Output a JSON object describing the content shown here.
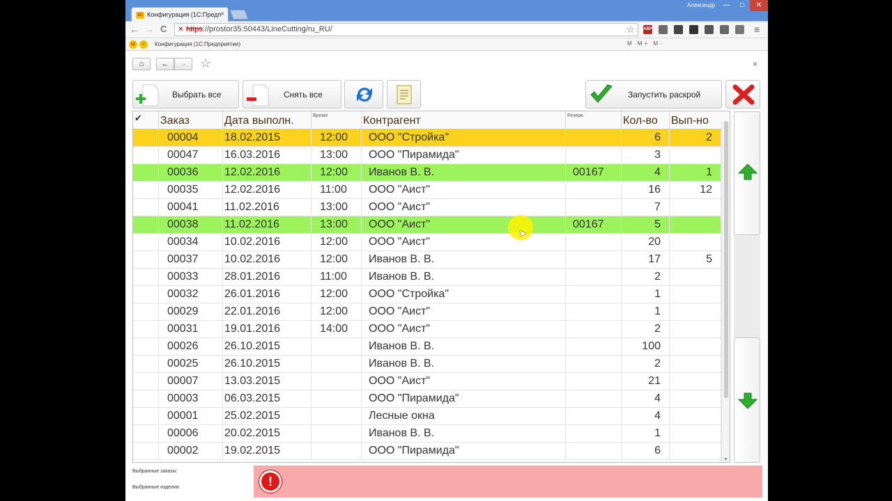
{
  "browser": {
    "tab_title": "Конфигурация (1С:Предп",
    "tab_favicon": "1С",
    "user": "Александр",
    "url_scheme": "https",
    "url_rest": "://prostor35:50443/LineCutting/ru_RU/",
    "bookmark_title": "Конфигурация  (1С:Предприятие)",
    "bookmark_logo": "1С",
    "toolbar_tools": "M M+ M-",
    "window_buttons": {
      "minimize": "—",
      "maximize": "□",
      "close": "✕"
    },
    "nav_icons": {
      "back": "←",
      "forward": "→",
      "reload": "C",
      "menu": "≡"
    },
    "extensions": [
      {
        "name": "adblock-icon",
        "label": "ABP",
        "color": "#c8201a"
      },
      {
        "name": "extension-icon-2",
        "label": "",
        "color": "#6a6a6a"
      },
      {
        "name": "extension-icon-3",
        "label": "",
        "color": "#444444"
      },
      {
        "name": "pocket-icon",
        "label": "",
        "color": "#333333"
      },
      {
        "name": "extension-icon-5",
        "label": "",
        "color": "#555555"
      },
      {
        "name": "extension-icon-6",
        "label": "",
        "color": "#666666"
      },
      {
        "name": "extension-icon-7",
        "label": "",
        "color": "#777777"
      }
    ]
  },
  "app": {
    "nav": {
      "home": "⌂",
      "back": "←",
      "forward": "→",
      "favorite": "☆"
    },
    "close": "×",
    "toolbar": {
      "select_all": "Выбрать все",
      "deselect_all": "Снять все",
      "start_cutting": "Запустить раскрой"
    },
    "table": {
      "headers": {
        "check": "✔",
        "order": "Заказ",
        "date": "Дата выполн.",
        "time": "Время",
        "counterparty": "Контрагент",
        "reserve": "Резерв",
        "qty": "Кол-во",
        "done": "Вып-но"
      },
      "rows": [
        {
          "order": "00004",
          "date": "18.02.2015",
          "time": "12:00",
          "counterparty": "ООО \"Стройка\"",
          "reserve": "",
          "qty": "6",
          "done": "2",
          "highlight": "yellow"
        },
        {
          "order": "00047",
          "date": "16.03.2016",
          "time": "13:00",
          "counterparty": "ООО \"Пирамида\"",
          "reserve": "",
          "qty": "3",
          "done": "",
          "highlight": ""
        },
        {
          "order": "00036",
          "date": "12.02.2016",
          "time": "12:00",
          "counterparty": "Иванов В. В.",
          "reserve": "00167",
          "qty": "4",
          "done": "1",
          "highlight": "green"
        },
        {
          "order": "00035",
          "date": "12.02.2016",
          "time": "11:00",
          "counterparty": "ООО \"Аист\"",
          "reserve": "",
          "qty": "16",
          "done": "12",
          "highlight": ""
        },
        {
          "order": "00041",
          "date": "11.02.2016",
          "time": "13:00",
          "counterparty": "ООО \"Аист\"",
          "reserve": "",
          "qty": "7",
          "done": "",
          "highlight": ""
        },
        {
          "order": "00038",
          "date": "11.02.2016",
          "time": "13:00",
          "counterparty": "ООО \"Аист\"",
          "reserve": "00167",
          "qty": "5",
          "done": "",
          "highlight": "green"
        },
        {
          "order": "00034",
          "date": "10.02.2016",
          "time": "12:00",
          "counterparty": "ООО \"Аист\"",
          "reserve": "",
          "qty": "20",
          "done": "",
          "highlight": ""
        },
        {
          "order": "00037",
          "date": "10.02.2016",
          "time": "12:00",
          "counterparty": "Иванов В. В.",
          "reserve": "",
          "qty": "17",
          "done": "5",
          "highlight": ""
        },
        {
          "order": "00033",
          "date": "28.01.2016",
          "time": "11:00",
          "counterparty": "Иванов В. В.",
          "reserve": "",
          "qty": "2",
          "done": "",
          "highlight": ""
        },
        {
          "order": "00032",
          "date": "26.01.2016",
          "time": "12:00",
          "counterparty": "ООО \"Стройка\"",
          "reserve": "",
          "qty": "1",
          "done": "",
          "highlight": ""
        },
        {
          "order": "00029",
          "date": "22.01.2016",
          "time": "12:00",
          "counterparty": "ООО \"Аист\"",
          "reserve": "",
          "qty": "1",
          "done": "",
          "highlight": ""
        },
        {
          "order": "00031",
          "date": "19.01.2016",
          "time": "14:00",
          "counterparty": "ООО \"Аист\"",
          "reserve": "",
          "qty": "2",
          "done": "",
          "highlight": ""
        },
        {
          "order": "00026",
          "date": "26.10.2015",
          "time": "",
          "counterparty": "Иванов В. В.",
          "reserve": "",
          "qty": "100",
          "done": "",
          "highlight": ""
        },
        {
          "order": "00025",
          "date": "26.10.2015",
          "time": "",
          "counterparty": "Иванов В. В.",
          "reserve": "",
          "qty": "2",
          "done": "",
          "highlight": ""
        },
        {
          "order": "00007",
          "date": "13.03.2015",
          "time": "",
          "counterparty": "ООО \"Аист\"",
          "reserve": "",
          "qty": "21",
          "done": "",
          "highlight": ""
        },
        {
          "order": "00003",
          "date": "06.03.2015",
          "time": "",
          "counterparty": "ООО \"Пирамида\"",
          "reserve": "",
          "qty": "4",
          "done": "",
          "highlight": ""
        },
        {
          "order": "00001",
          "date": "25.02.2015",
          "time": "",
          "counterparty": "Лесные окна",
          "reserve": "",
          "qty": "4",
          "done": "",
          "highlight": ""
        },
        {
          "order": "00006",
          "date": "20.02.2015",
          "time": "",
          "counterparty": "Иванов В. В.",
          "reserve": "",
          "qty": "1",
          "done": "",
          "highlight": ""
        },
        {
          "order": "00002",
          "date": "19.02.2015",
          "time": "",
          "counterparty": "ООО \"Пирамида\"",
          "reserve": "",
          "qty": "6",
          "done": "",
          "highlight": ""
        }
      ]
    },
    "footer": {
      "selected_orders_label": "Выбранные заказы:",
      "selected_items_label": "Выбранные изделия:",
      "error_icon": "!"
    },
    "colors": {
      "yellow_row": "#fdd21c",
      "green_row": "#9cf35c",
      "message_bg": "#f8a9a9",
      "header_text": "#4a2e12"
    }
  }
}
